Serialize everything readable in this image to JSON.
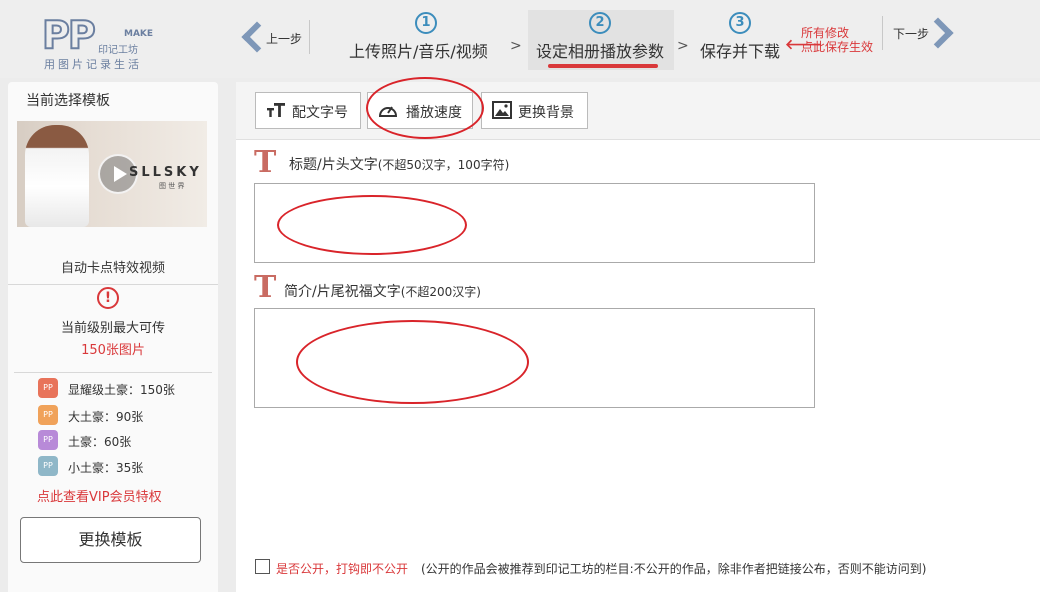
{
  "logo": {
    "letters": "PP",
    "make": "MAKE",
    "name": "印记工坊",
    "slogan": "用图片记录生活"
  },
  "nav": {
    "prev_label": "上一步",
    "next_label": "下一步",
    "steps": [
      {
        "num": "1",
        "label": "上传照片/音乐/视频",
        "active": false
      },
      {
        "num": "2",
        "label": "设定相册播放参数",
        "active": true
      },
      {
        "num": "3",
        "label": "保存并下载",
        "active": false
      }
    ],
    "separator": ">",
    "save_hint_line1": "所有修改",
    "save_hint_line2": "点此保存生效",
    "save_hint_arrow": "🡐"
  },
  "sidebar": {
    "title": "当前选择模板",
    "template_brand": "SLLSKY",
    "template_brand_sub": "图 世 界",
    "template_name": "自动卡点特效视频",
    "warn_symbol": "!",
    "max_label": "当前级别最大可传",
    "max_value": "150张图片",
    "levels": [
      {
        "label": "显耀级土豪：150张",
        "color": "#e8735a"
      },
      {
        "label": "大土豪：90张",
        "color": "#f0a25a"
      },
      {
        "label": "土豪：60张",
        "color": "#b88ad8"
      },
      {
        "label": "小土豪：35张",
        "color": "#8fb7c8"
      }
    ],
    "level_icon_text": "PP",
    "vip_link": "点此查看VIP会员特权",
    "change_template_button": "更换模板"
  },
  "toolbar": {
    "buttons": [
      {
        "label": "配文字号",
        "icon": "text-size-icon"
      },
      {
        "label": "播放速度",
        "icon": "speedometer-icon"
      },
      {
        "label": "更换背景",
        "icon": "image-icon"
      }
    ]
  },
  "form": {
    "t_glyph": "T",
    "title_field_label": "标题/片头文字",
    "title_field_hint": "(不超50汉字，100字符)",
    "title_value": "",
    "intro_field_label": "简介/片尾祝福文字",
    "intro_field_hint": "(不超200汉字)",
    "intro_value": ""
  },
  "public": {
    "checked": false,
    "label": "是否公开，打钩即不公开",
    "note": "(公开的作品会被推荐到印记工坊的栏目:不公开的作品，除非作者把链接公布，否则不能访问到)"
  },
  "colors": {
    "accent_red": "#d9383a",
    "step_blue": "#3c8dbc",
    "chevron_blue": "#7e97b8",
    "t_glyph": "#c96b62"
  }
}
